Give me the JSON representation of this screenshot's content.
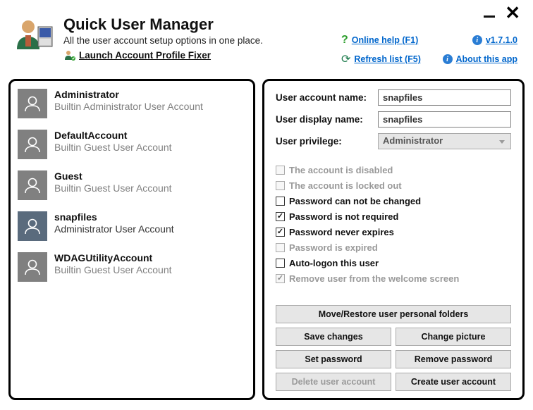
{
  "header": {
    "title": "Quick User Manager",
    "subtitle": "All the user account setup options in one place.",
    "launch_fixer": "Launch Account Profile Fixer"
  },
  "links": {
    "online_help": "Online help (F1)",
    "version": "v1.7.1.0",
    "refresh": "Refresh list (F5)",
    "about": "About this app"
  },
  "users": [
    {
      "name": "Administrator",
      "desc": "Builtin Administrator User Account",
      "selected": false
    },
    {
      "name": "DefaultAccount",
      "desc": "Builtin Guest User Account",
      "selected": false
    },
    {
      "name": "Guest",
      "desc": "Builtin Guest User Account",
      "selected": false
    },
    {
      "name": "snapfiles",
      "desc": "Administrator User Account",
      "selected": true
    },
    {
      "name": "WDAGUtilityAccount",
      "desc": "Builtin Guest User Account",
      "selected": false
    }
  ],
  "details": {
    "labels": {
      "account_name": "User account name:",
      "display_name": "User display name:",
      "privilege": "User privilege:"
    },
    "values": {
      "account_name": "snapfiles",
      "display_name": "snapfiles",
      "privilege": "Administrator"
    }
  },
  "checks": [
    {
      "label": "The account is disabled",
      "checked": false,
      "disabled": true
    },
    {
      "label": "The account is locked out",
      "checked": false,
      "disabled": true
    },
    {
      "label": "Password can not be changed",
      "checked": false,
      "disabled": false
    },
    {
      "label": "Password is not required",
      "checked": true,
      "disabled": false
    },
    {
      "label": "Password never expires",
      "checked": true,
      "disabled": false
    },
    {
      "label": "Password is expired",
      "checked": false,
      "disabled": true
    },
    {
      "label": "Auto-logon this user",
      "checked": false,
      "disabled": false
    },
    {
      "label": "Remove user from the welcome screen",
      "checked": true,
      "disabled": true
    }
  ],
  "buttons": {
    "move_restore": "Move/Restore user personal folders",
    "save": "Save changes",
    "change_pic": "Change picture",
    "set_pwd": "Set password",
    "remove_pwd": "Remove password",
    "delete_user": "Delete user account",
    "create_user": "Create user account"
  }
}
